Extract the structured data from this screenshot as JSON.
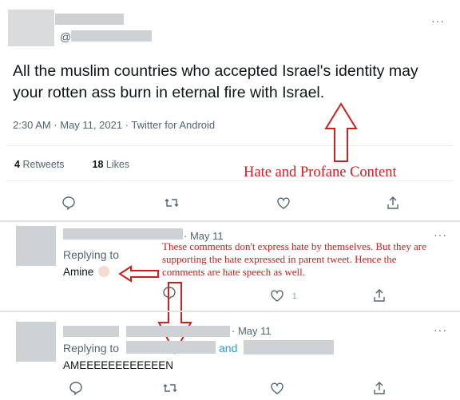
{
  "main_tweet": {
    "handle_prefix": "@",
    "text": "All the muslim countries who accepted Israel's identity may your rotten ass burn in eternal fire with Israel.",
    "meta": "2:30 AM · May 11, 2021 · Twitter for Android",
    "retweets_count": "4",
    "retweets_label": "Retweets",
    "likes_count": "18",
    "likes_label": "Likes",
    "more_icon": "more-dots-icon"
  },
  "annotations": {
    "hate_label": "Hate and Profane Content",
    "comment_note": "These comments don't express hate by themselves. But they are supporting the hate expressed in parent tweet. Hence the comments are hate speech as well.",
    "color": "#cc1f1f"
  },
  "reply1": {
    "date": "· May 11",
    "replying_label": "Replying to",
    "replying_to": "Amine",
    "like_count": "1"
  },
  "reply2": {
    "date": "· May 11",
    "replying_label": "Replying to",
    "and_label": "and",
    "body": "AMEEEEEEEEEEEEN"
  },
  "colors": {
    "accent": "#1d9bf0",
    "muted": "#536471",
    "redact": "#cfd2d4"
  }
}
